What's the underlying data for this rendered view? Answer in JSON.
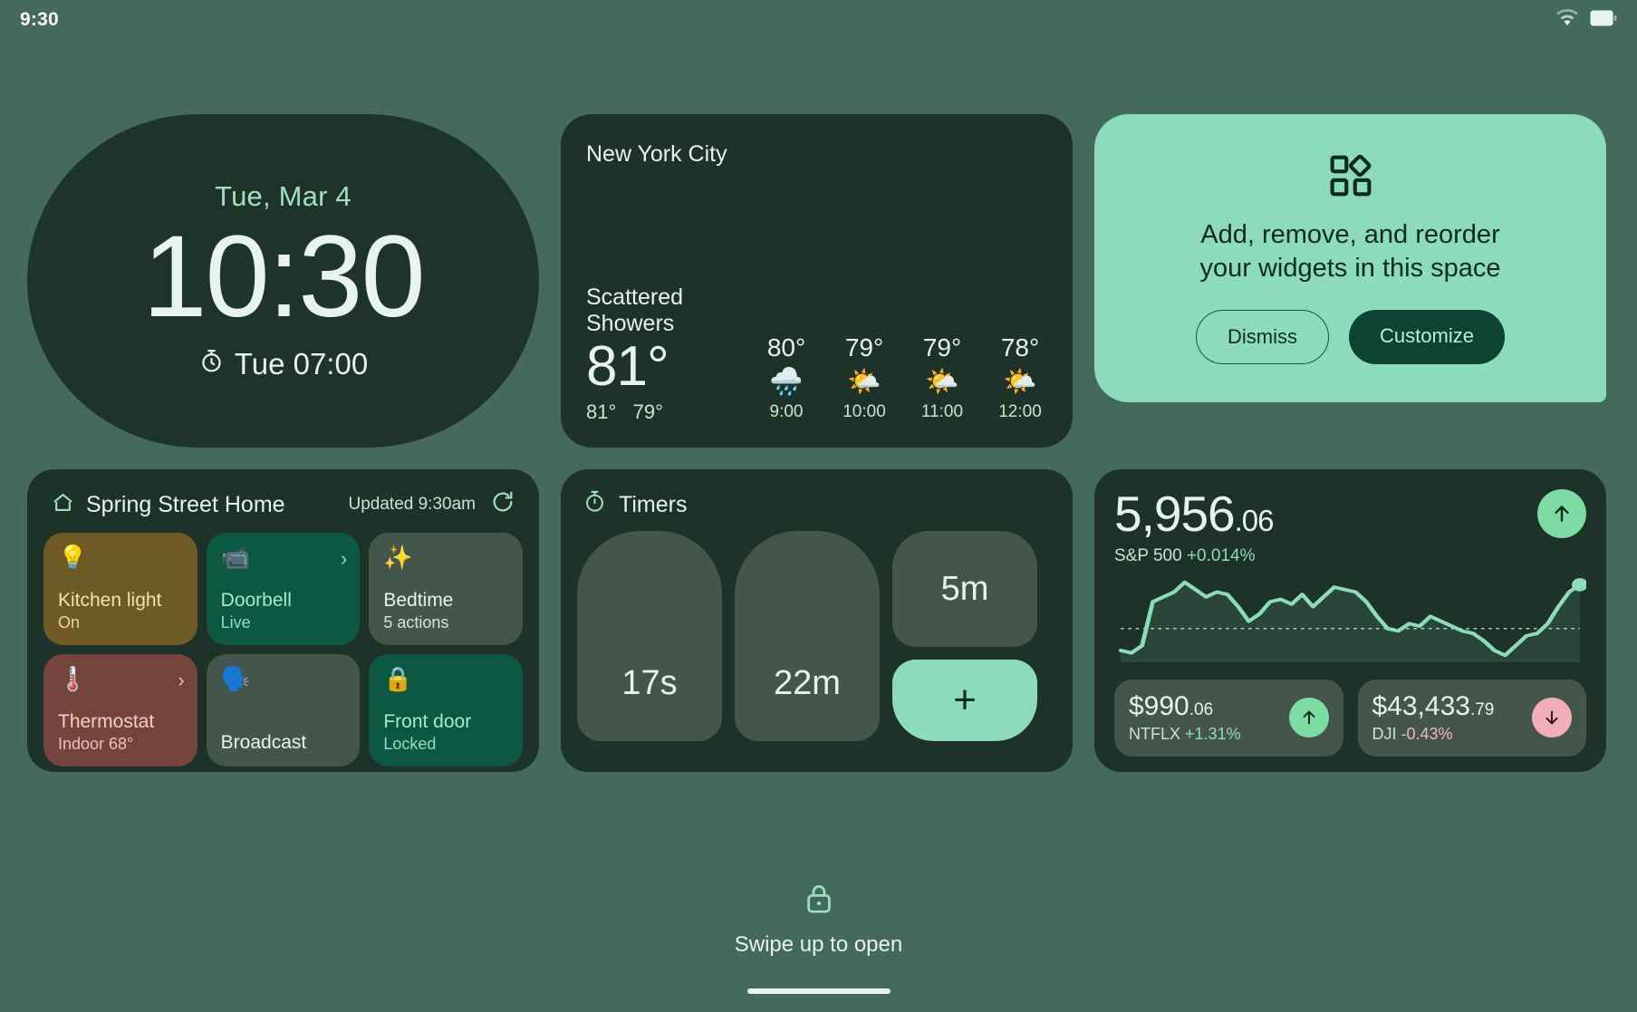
{
  "statusbar": {
    "time": "9:30",
    "wifi_icon": "wifi-icon",
    "battery_icon": "battery-icon"
  },
  "clock": {
    "date": "Tue, Mar 4",
    "time": "10:30",
    "alarm": "Tue 07:00",
    "alarm_icon": "alarm-clock-icon"
  },
  "weather": {
    "city": "New York City",
    "condition": "Scattered Showers",
    "temperature": "81°",
    "high": "81°",
    "low": "79°",
    "hours": [
      {
        "temp": "80°",
        "icon": "rain-cloud-icon",
        "glyph": "🌧️",
        "time": "9:00"
      },
      {
        "temp": "79°",
        "icon": "sun-behind-cloud-icon",
        "glyph": "🌤️",
        "time": "10:00"
      },
      {
        "temp": "79°",
        "icon": "sun-behind-cloud-icon",
        "glyph": "🌤️",
        "time": "11:00"
      },
      {
        "temp": "78°",
        "icon": "sun-behind-cloud-icon",
        "glyph": "🌤️",
        "time": "12:00"
      }
    ]
  },
  "promo": {
    "icon": "widgets-icon",
    "message_line1": "Add, remove, and reorder",
    "message_line2": "your widgets in this space",
    "dismiss_label": "Dismiss",
    "customize_label": "Customize",
    "background": "#8cdcbc",
    "customize_bg": "#0e4233"
  },
  "home": {
    "icon": "house-icon",
    "title": "Spring Street Home",
    "updated": "Updated 9:30am",
    "refresh_icon": "refresh-icon",
    "tiles": [
      {
        "name": "Kitchen light",
        "status": "On",
        "icon": "lightbulb-icon",
        "glyph": "💡",
        "style": "tile-amber",
        "chevron": ""
      },
      {
        "name": "Doorbell",
        "status": "Live",
        "icon": "video-camera-icon",
        "glyph": "📹",
        "style": "tile-green",
        "chevron": "›"
      },
      {
        "name": "Bedtime",
        "status": "5 actions",
        "icon": "sparkle-icon",
        "glyph": "✨",
        "style": "tile-gray",
        "chevron": ""
      },
      {
        "name": "Thermostat",
        "status": "Indoor 68°",
        "icon": "thermostat-icon",
        "glyph": "🌡️",
        "style": "tile-red",
        "chevron": "›"
      },
      {
        "name": "Broadcast",
        "status": "",
        "icon": "broadcast-icon",
        "glyph": "🗣️",
        "style": "tile-gray",
        "chevron": ""
      },
      {
        "name": "Front door",
        "status": "Locked",
        "icon": "lock-icon",
        "glyph": "🔒",
        "style": "tile-green",
        "chevron": ""
      }
    ]
  },
  "timers": {
    "icon": "stopwatch-icon",
    "title": "Timers",
    "items": [
      "17s",
      "22m",
      "5m"
    ],
    "add_label": "+"
  },
  "stocks": {
    "index_whole": "5,956",
    "index_cents": ".06",
    "index_name": "S&P 500",
    "index_change": "+0.014%",
    "index_arrow": "arrow-up-icon",
    "cards": [
      {
        "price_whole": "$990",
        "price_cents": ".06",
        "ticker": "NTFLX",
        "change": "+1.31%",
        "direction": "up",
        "arrow": "arrow-up-icon"
      },
      {
        "price_whole": "$43,433",
        "price_cents": ".79",
        "ticker": "DJI",
        "change": "-0.43%",
        "direction": "down",
        "arrow": "arrow-down-icon"
      }
    ],
    "accent_up": "#7ddba4",
    "accent_down": "#f0aeb8"
  },
  "chart_data": {
    "type": "line",
    "title": "S&P 500 intraday sparkline",
    "xlabel": "",
    "ylabel": "",
    "grid": false,
    "legend": "none",
    "series": [
      {
        "name": "S&P 500",
        "values": [
          2,
          1,
          4,
          22,
          24,
          26,
          30,
          27,
          24,
          26,
          25,
          20,
          14,
          17,
          22,
          23,
          21,
          25,
          20,
          24,
          28,
          27,
          26,
          22,
          16,
          11,
          10,
          13,
          12,
          16,
          14,
          12,
          10,
          9,
          6,
          2,
          0,
          4,
          8,
          9,
          13,
          20,
          26,
          29
        ]
      }
    ],
    "baseline": 11,
    "endpoint_marker": true,
    "line_color": "#8cdcbc",
    "fill_color": "rgba(140,220,188,0.10)"
  },
  "bottom": {
    "lock_icon": "lock-icon",
    "swipe_text": "Swipe up to open",
    "home_indicator": "home-indicator"
  }
}
